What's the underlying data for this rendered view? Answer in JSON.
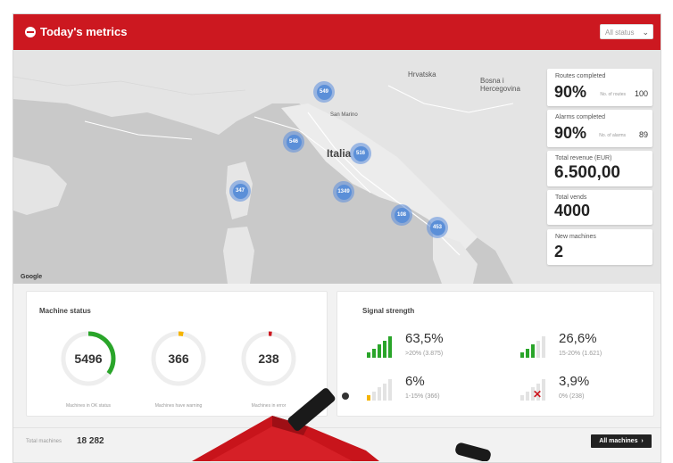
{
  "header": {
    "title": "Today's metrics",
    "status_select": "All status",
    "brand_color": "#cc1820"
  },
  "map": {
    "labels": {
      "country": "Italia",
      "hrvatska": "Hrvatska",
      "bosnia": "Bosna i\nHercegovina",
      "san_marino": "San Marino",
      "google": "Google"
    },
    "clusters": [
      "549",
      "546",
      "516",
      "347",
      "1349",
      "108",
      "453"
    ]
  },
  "kpis": [
    {
      "label": "Routes completed",
      "value": "90%",
      "sub": "No. of routes",
      "subval": "100"
    },
    {
      "label": "Alarms completed",
      "value": "90%",
      "sub": "No. of alarms",
      "subval": "89"
    },
    {
      "label": "Total revenue (EUR)",
      "value": "6.500,00"
    },
    {
      "label": "Total vends",
      "value": "4000"
    },
    {
      "label": "New machines",
      "value": "2"
    }
  ],
  "machine_status": {
    "title": "Machine status",
    "gauges": [
      {
        "value": "5496",
        "caption": "Machines in OK status",
        "color": "#2aa52a",
        "fraction": 0.35
      },
      {
        "value": "366",
        "caption": "Machines have warning",
        "color": "#f5b400",
        "fraction": 0.03
      },
      {
        "value": "238",
        "caption": "Machines in error",
        "color": "#cc1820",
        "fraction": 0.02
      }
    ]
  },
  "signal_strength": {
    "title": "Signal strength",
    "items": [
      {
        "pct": "63,5%",
        "detail": ">20%  (3.875)",
        "bars": 5,
        "color": "#2aa52a"
      },
      {
        "pct": "26,6%",
        "detail": "15-20%  (1.621)",
        "bars": 3,
        "color": "#2aa52a"
      },
      {
        "pct": "6%",
        "detail": "1-15%  (366)",
        "bars": 1,
        "color": "#f5b400"
      },
      {
        "pct": "3,9%",
        "detail": "0%  (238)",
        "bars": 0,
        "color": "#cc1820"
      }
    ]
  },
  "footer": {
    "total_label": "Total machines",
    "total_value": "18 282",
    "all_machines_button": "All machines",
    "all_machines_icon": "chevron-right-icon"
  }
}
